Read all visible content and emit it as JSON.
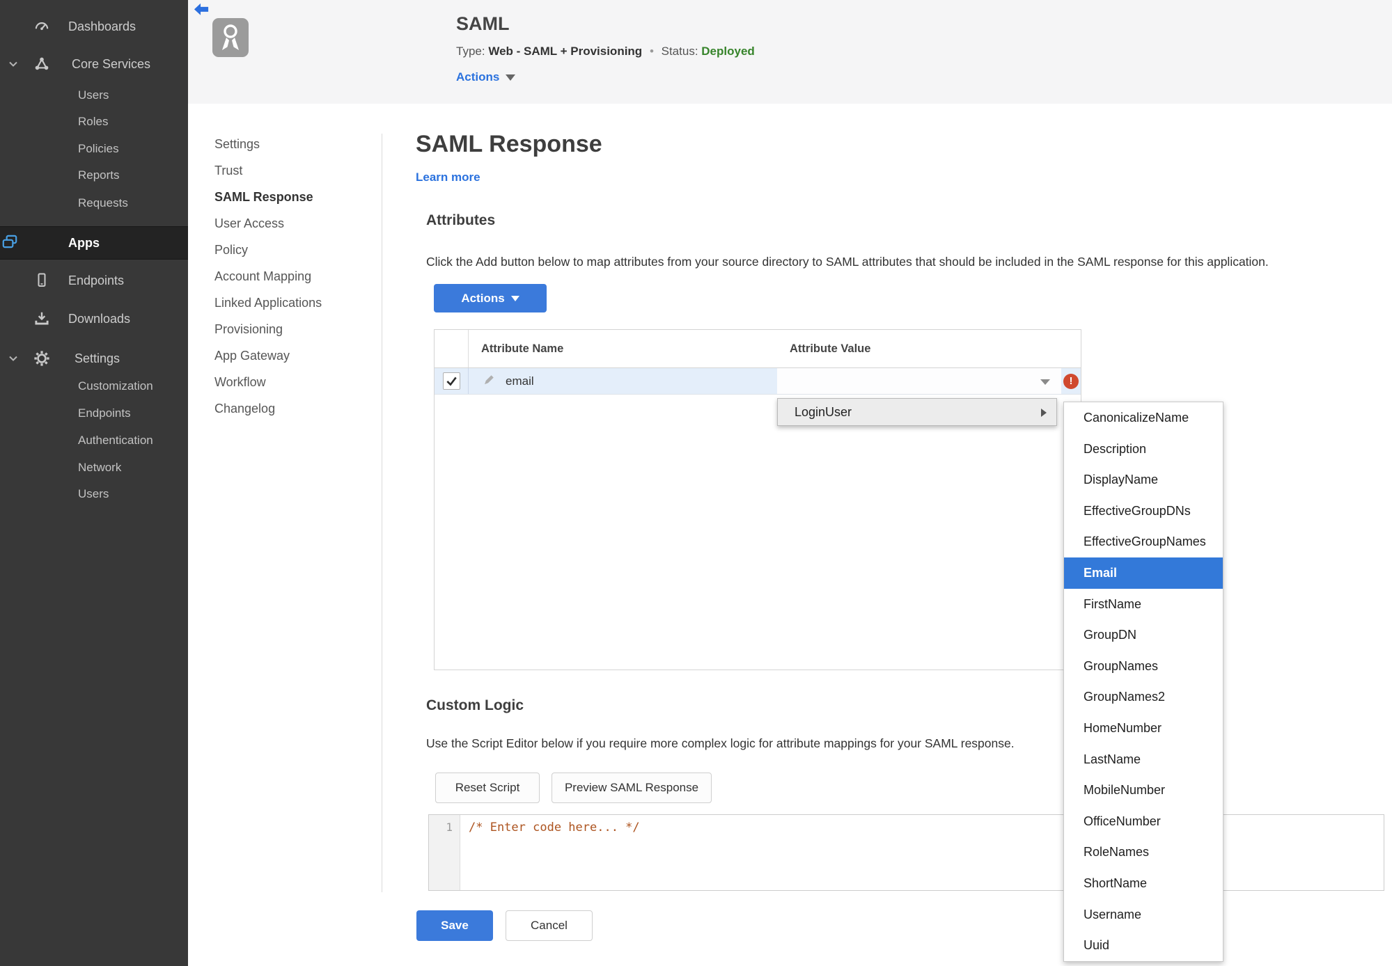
{
  "sidebar": {
    "dashboards": "Dashboards",
    "core_services": "Core Services",
    "core_items": [
      "Users",
      "Roles",
      "Policies",
      "Reports",
      "Requests"
    ],
    "apps": "Apps",
    "endpoints": "Endpoints",
    "downloads": "Downloads",
    "settings": "Settings",
    "settings_items": [
      "Customization",
      "Endpoints",
      "Authentication",
      "Network",
      "Users"
    ]
  },
  "header": {
    "app_name": "SAML",
    "type_label": "Type:",
    "type_value": "Web - SAML + Provisioning",
    "dot": "•",
    "status_label": "Status:",
    "status_value": "Deployed",
    "actions_label": "Actions"
  },
  "subnav": {
    "items": [
      "Settings",
      "Trust",
      "SAML Response",
      "User Access",
      "Policy",
      "Account Mapping",
      "Linked Applications",
      "Provisioning",
      "App Gateway",
      "Workflow",
      "Changelog"
    ],
    "active_item": "SAML Response"
  },
  "main": {
    "title": "SAML Response",
    "learn_more": "Learn more",
    "attributes": {
      "heading": "Attributes",
      "description": "Click the Add button below to map attributes from your source directory to SAML attributes that should be included in the SAML response for this application.",
      "actions_button": "Actions",
      "table": {
        "columns": [
          "Attribute Name",
          "Attribute Value"
        ],
        "row": {
          "name": "email",
          "value": "",
          "checked": true
        }
      }
    },
    "value_menu": {
      "parent": "LoginUser",
      "items": [
        "CanonicalizeName",
        "Description",
        "DisplayName",
        "EffectiveGroupDNs",
        "EffectiveGroupNames",
        "Email",
        "FirstName",
        "GroupDN",
        "GroupNames",
        "GroupNames2",
        "HomeNumber",
        "LastName",
        "MobileNumber",
        "OfficeNumber",
        "RoleNames",
        "ShortName",
        "Username",
        "Uuid"
      ],
      "selected": "Email"
    },
    "custom_logic": {
      "heading": "Custom Logic",
      "description": "Use the Script Editor below if you require more complex logic for attribute mappings for your SAML response.",
      "reset_button": "Reset Script",
      "preview_button": "Preview SAML Response",
      "editor": {
        "line_number": "1",
        "code": "/* Enter code here... */"
      }
    },
    "footer": {
      "save": "Save",
      "cancel": "Cancel"
    },
    "error_badge": "!"
  },
  "colors": {
    "accent_blue": "#3b7adb",
    "selection_blue": "#3379d9",
    "status_green": "#37842b",
    "error_red": "#d0492f",
    "row_highlight": "#e4eefa"
  },
  "icons": {
    "dashboards": "gauge-icon",
    "core_services": "nodes-icon",
    "apps": "apps-icon",
    "endpoints": "mobile-icon",
    "downloads": "download-icon",
    "settings": "gear-icon",
    "back": "back-arrow-icon",
    "app_logo": "award-ribbon-icon",
    "edit": "pencil-icon",
    "error": "error-icon",
    "open_value_list": "caret-down-icon",
    "submenu_arrow": "caret-right-icon"
  }
}
